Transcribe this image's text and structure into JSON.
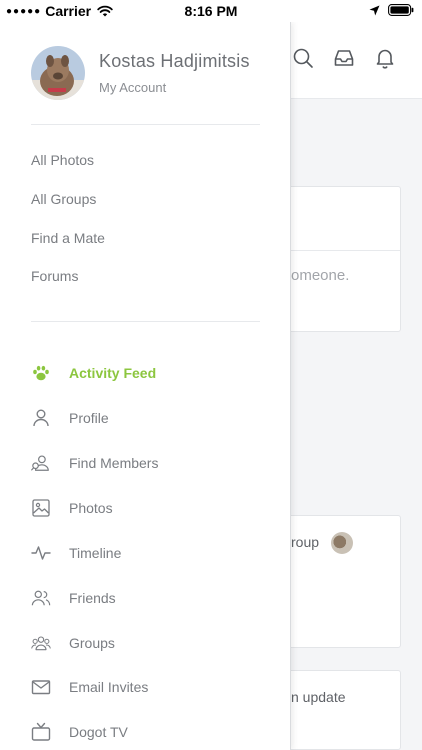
{
  "status_bar": {
    "carrier": "Carrier",
    "time": "8:16 PM"
  },
  "drawer": {
    "user_name": "Kostas Hadjimitsis",
    "user_subtitle": "My Account",
    "links": [
      "All Photos",
      "All Groups",
      "Find a Mate",
      "Forums"
    ],
    "nav": [
      {
        "label": "Activity Feed",
        "icon": "paw-icon",
        "active": true
      },
      {
        "label": "Profile",
        "icon": "user-icon"
      },
      {
        "label": "Find Members",
        "icon": "find-members-icon"
      },
      {
        "label": "Photos",
        "icon": "image-icon"
      },
      {
        "label": "Timeline",
        "icon": "pulse-icon"
      },
      {
        "label": "Friends",
        "icon": "friends-icon"
      },
      {
        "label": "Groups",
        "icon": "groups-icon"
      },
      {
        "label": "Email Invites",
        "icon": "mail-icon"
      },
      {
        "label": "Dogot TV",
        "icon": "tv-icon"
      }
    ]
  },
  "background": {
    "header_icons": [
      "search-icon",
      "inbox-icon",
      "bell-icon"
    ],
    "partial_text_1": "omeone.",
    "partial_text_2": "roup",
    "partial_text_3": "n update"
  },
  "colors": {
    "accent": "#8cc63f",
    "text": "#7a7d82",
    "divider": "#e7e9ec"
  }
}
